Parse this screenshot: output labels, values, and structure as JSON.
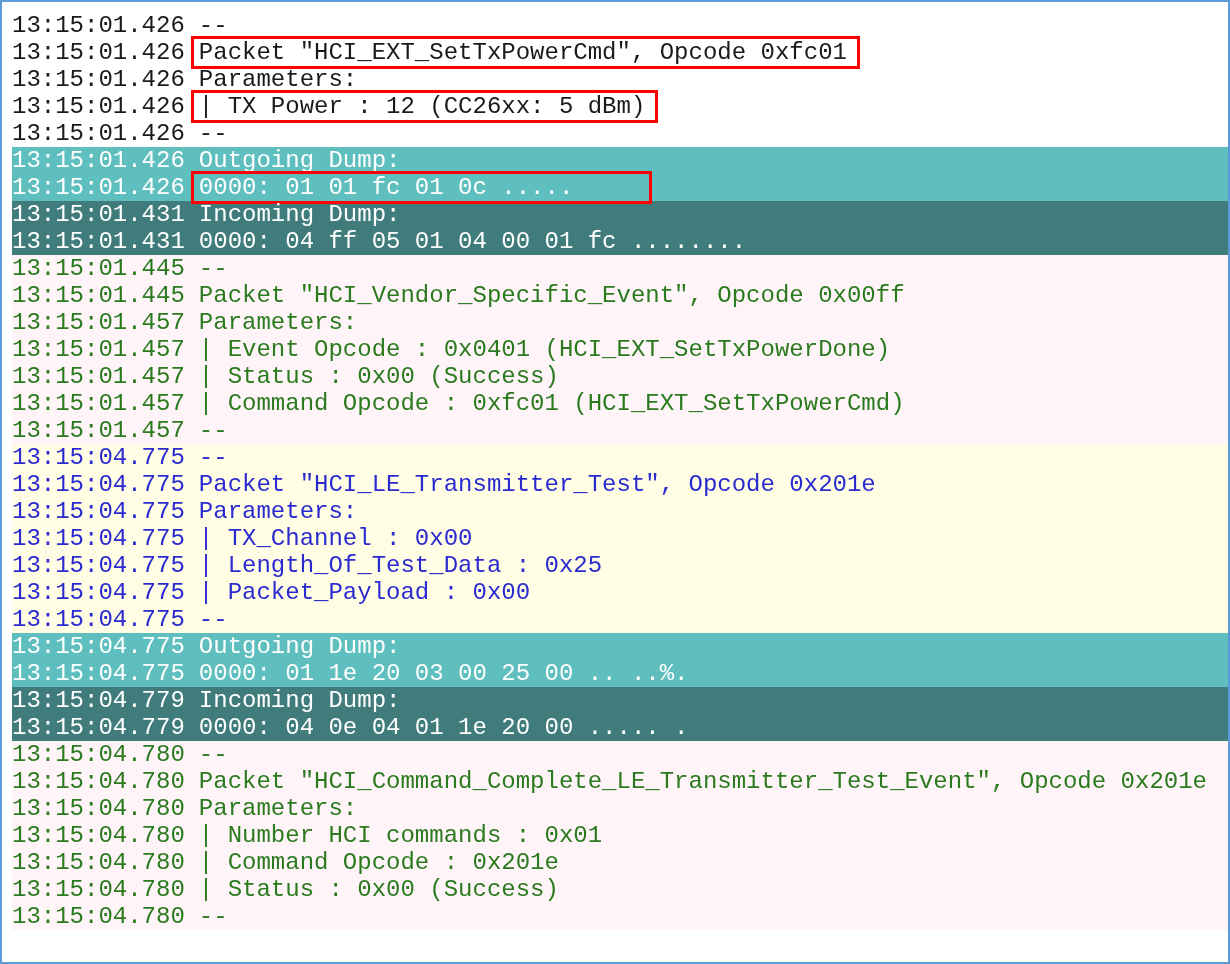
{
  "log_blocks": [
    {
      "kind": "info",
      "lines": [
        {
          "time": "13:15:01.426",
          "text": "--",
          "highlighted": false
        },
        {
          "time": "13:15:01.426",
          "text": "Packet \"HCI_EXT_SetTxPowerCmd\", Opcode 0xfc01",
          "highlighted": true
        },
        {
          "time": "13:15:01.426",
          "text": "Parameters:",
          "highlighted": false
        },
        {
          "time": "13:15:01.426",
          "text": "| TX Power : 12 (CC26xx: 5 dBm)",
          "highlighted": true
        },
        {
          "time": "13:15:01.426",
          "text": "--",
          "highlighted": false
        }
      ]
    },
    {
      "kind": "outgoing",
      "lines": [
        {
          "time": "13:15:01.426",
          "text": "Outgoing Dump:",
          "highlighted": false
        },
        {
          "time": "13:15:01.426",
          "text": "0000: 01 01 fc 01 0c .....",
          "highlighted": true
        }
      ]
    },
    {
      "kind": "incoming",
      "lines": [
        {
          "time": "13:15:01.431",
          "text": "Incoming Dump:",
          "highlighted": false
        },
        {
          "time": "13:15:01.431",
          "text": "0000: 04 ff 05 01 04 00 01 fc ........",
          "highlighted": false
        }
      ]
    },
    {
      "kind": "event",
      "lines": [
        {
          "time": "13:15:01.445",
          "text": "--",
          "highlighted": false
        },
        {
          "time": "13:15:01.445",
          "text": "Packet \"HCI_Vendor_Specific_Event\", Opcode 0x00ff",
          "highlighted": false
        },
        {
          "time": "13:15:01.457",
          "text": "Parameters:",
          "highlighted": false
        },
        {
          "time": "13:15:01.457",
          "text": "| Event Opcode : 0x0401 (HCI_EXT_SetTxPowerDone)",
          "highlighted": false
        },
        {
          "time": "13:15:01.457",
          "text": "| Status : 0x00 (Success)",
          "highlighted": false
        },
        {
          "time": "13:15:01.457",
          "text": "| Command Opcode : 0xfc01 (HCI_EXT_SetTxPowerCmd)",
          "highlighted": false
        },
        {
          "time": "13:15:01.457",
          "text": "--",
          "highlighted": false
        }
      ]
    },
    {
      "kind": "command",
      "lines": [
        {
          "time": "13:15:04.775",
          "text": "--",
          "highlighted": false
        },
        {
          "time": "13:15:04.775",
          "text": "Packet \"HCI_LE_Transmitter_Test\", Opcode 0x201e",
          "highlighted": false
        },
        {
          "time": "13:15:04.775",
          "text": "Parameters:",
          "highlighted": false
        },
        {
          "time": "13:15:04.775",
          "text": "| TX_Channel : 0x00",
          "highlighted": false
        },
        {
          "time": "13:15:04.775",
          "text": "| Length_Of_Test_Data : 0x25",
          "highlighted": false
        },
        {
          "time": "13:15:04.775",
          "text": "| Packet_Payload : 0x00",
          "highlighted": false
        },
        {
          "time": "13:15:04.775",
          "text": "--",
          "highlighted": false
        }
      ]
    },
    {
      "kind": "outgoing",
      "lines": [
        {
          "time": "13:15:04.775",
          "text": "Outgoing Dump:",
          "highlighted": false
        },
        {
          "time": "13:15:04.775",
          "text": "0000: 01 1e 20 03 00 25 00 .. ..%.",
          "highlighted": false
        }
      ]
    },
    {
      "kind": "incoming",
      "lines": [
        {
          "time": "13:15:04.779",
          "text": "Incoming Dump:",
          "highlighted": false
        },
        {
          "time": "13:15:04.779",
          "text": "0000: 04 0e 04 01 1e 20 00 ..... .",
          "highlighted": false
        }
      ]
    },
    {
      "kind": "event",
      "lines": [
        {
          "time": "13:15:04.780",
          "text": "--",
          "highlighted": false
        },
        {
          "time": "13:15:04.780",
          "text": "Packet \"HCI_Command_Complete_LE_Transmitter_Test_Event\", Opcode 0x201e",
          "highlighted": false
        },
        {
          "time": "13:15:04.780",
          "text": "Parameters:",
          "highlighted": false
        },
        {
          "time": "13:15:04.780",
          "text": "| Number HCI commands : 0x01",
          "highlighted": false
        },
        {
          "time": "13:15:04.780",
          "text": "| Command Opcode : 0x201e",
          "highlighted": false
        },
        {
          "time": "13:15:04.780",
          "text": "| Status : 0x00 (Success)",
          "highlighted": false
        },
        {
          "time": "13:15:04.780",
          "text": "--",
          "highlighted": false
        }
      ]
    }
  ]
}
